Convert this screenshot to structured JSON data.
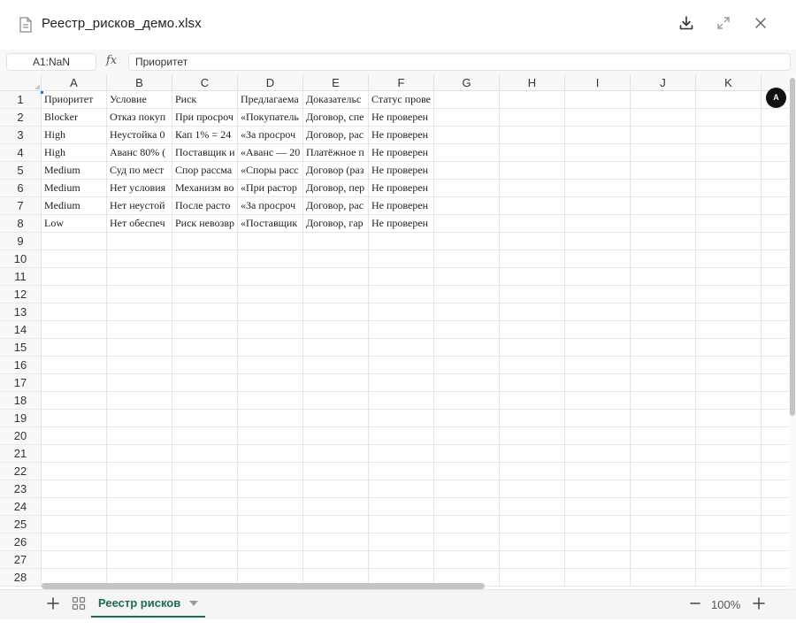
{
  "window": {
    "title": "Реестр_рисков_демо.xlsx"
  },
  "formula_bar": {
    "cell_ref": "A1:NaN",
    "fx_label": "fx",
    "value": "Приоритет"
  },
  "columns": [
    "A",
    "B",
    "C",
    "D",
    "E",
    "F",
    "G",
    "H",
    "I",
    "J",
    "K"
  ],
  "rows": [
    "1",
    "2",
    "3",
    "4",
    "5",
    "6",
    "7",
    "8",
    "9",
    "10",
    "11",
    "12",
    "13",
    "14",
    "15",
    "16",
    "17",
    "18",
    "19",
    "20",
    "21",
    "22",
    "23",
    "24",
    "25",
    "26",
    "27",
    "28"
  ],
  "table": {
    "headers": [
      "Приоритет",
      "Условие",
      "Риск",
      "Предлагаема",
      "Доказательс",
      "Статус прове"
    ],
    "rows": [
      [
        "Blocker",
        "Отказ покуп",
        "При просроч",
        "«Покупатель",
        "Договор, спе",
        "Не проверен"
      ],
      [
        "High",
        "Неустойка 0",
        "Кап 1% = 24",
        "«За просроч",
        "Договор, рас",
        "Не проверен"
      ],
      [
        "High",
        "Аванс 80% (",
        "Поставщик и",
        "«Аванс — 20",
        "Платёжное п",
        "Не проверен"
      ],
      [
        "Medium",
        "Суд по мест",
        "Спор рассма",
        "«Споры расс",
        "Договор (раз",
        "Не проверен"
      ],
      [
        "Medium",
        "Нет условия",
        "Механизм во",
        "«При растор",
        "Договор, пер",
        "Не проверен"
      ],
      [
        "Medium",
        "Нет неустой",
        "После расто",
        "«За просроч",
        "Договор, рас",
        "Не проверен"
      ],
      [
        "Low",
        "Нет обеспеч",
        "Риск невозвр",
        "«Поставщик",
        "Договор, гар",
        "Не проверен"
      ]
    ]
  },
  "presence": {
    "avatar_initial": "A"
  },
  "sheets": {
    "active_tab": "Реестр рисков"
  },
  "zoom": {
    "level": "100%"
  },
  "icons": {
    "file": "file-icon",
    "download": "download-icon",
    "expand": "expand-icon",
    "close": "close-icon",
    "add_sheet": "plus-icon",
    "all_sheets": "grid-icon",
    "zoom_out": "minus-icon",
    "zoom_in": "plus-icon"
  },
  "colors": {
    "accent": "#1f6b4a",
    "selection": "#1a73e8"
  }
}
